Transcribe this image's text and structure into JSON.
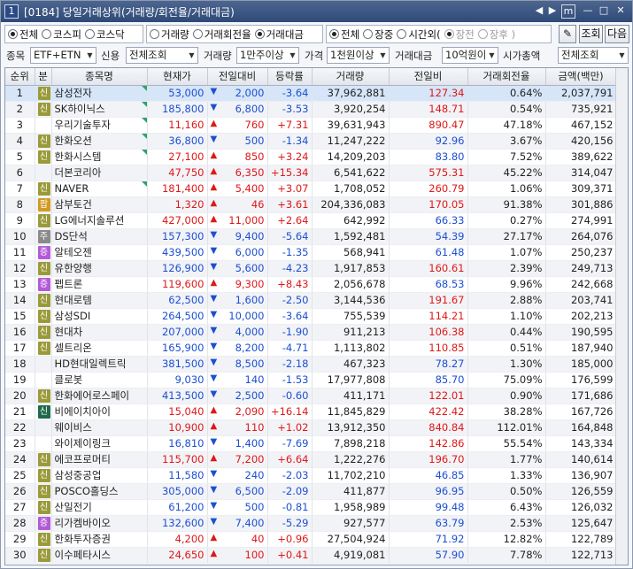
{
  "window": {
    "number": "1",
    "title": "[0184] 당일거래상위(거래량/회전율/거래대금)"
  },
  "title_controls": {
    "prev": "◀",
    "next": "▶",
    "m": "m",
    "minimize": "—",
    "maximize": "□",
    "close": "✕"
  },
  "market_filter": [
    {
      "label": "전체",
      "on": true
    },
    {
      "label": "코스피",
      "on": false
    },
    {
      "label": "코스닥",
      "on": false
    }
  ],
  "sort_filter": [
    {
      "label": "거래량",
      "on": false
    },
    {
      "label": "거래회전율",
      "on": false
    },
    {
      "label": "거래대금",
      "on": true
    }
  ],
  "session_filter": [
    {
      "label": "전체",
      "on": true,
      "dim": false
    },
    {
      "label": "장중",
      "on": false,
      "dim": false
    },
    {
      "label": "시간외(",
      "on": false,
      "dim": false
    },
    {
      "label": "장전",
      "on": true,
      "dim": true
    },
    {
      "label": "장후 )",
      "on": false,
      "dim": true
    }
  ],
  "buttons": {
    "search": "조회",
    "next": "다음",
    "tool_icon": "✎"
  },
  "filters": {
    "item_label": "종목",
    "item_value": "ETF+ETN 제",
    "credit_label": "신용",
    "credit_value": "전체조회",
    "volume_label": "거래량",
    "volume_value": "1만주이상",
    "price_label": "가격",
    "price_value": "1천원이상",
    "amount_label": "거래대금",
    "amount_value": "10억원이상",
    "mcap_label": "시가총액",
    "mcap_value": "전체조회"
  },
  "columns": [
    "순위",
    "분",
    "종목명",
    "현재가",
    "전일대비",
    "등락률",
    "거래량",
    "전일비",
    "거래회전율",
    "금액(백만)"
  ],
  "tag_colors": {
    "신": "#9a9a3a",
    "주": "#8a8a8a",
    "증": "#b35ad6",
    "팝": "#d29a24",
    "신2": "#1f6a4a"
  },
  "rows": [
    {
      "rank": "1",
      "tag": "신",
      "name": "삼성전자",
      "flag": true,
      "price": "53,000",
      "dir": "down",
      "chg": "2,000",
      "rate": "-3.64",
      "vol": "37,962,881",
      "prev": "127.34",
      "turn": "0.64%",
      "amt": "2,037,791"
    },
    {
      "rank": "2",
      "tag": "신",
      "name": "SK하이닉스",
      "flag": true,
      "price": "185,800",
      "dir": "down",
      "chg": "6,800",
      "rate": "-3.53",
      "vol": "3,920,254",
      "prev": "148.71",
      "turn": "0.54%",
      "amt": "735,921"
    },
    {
      "rank": "3",
      "tag": "",
      "name": "우리기술투자",
      "flag": true,
      "price": "11,160",
      "dir": "up",
      "chg": "760",
      "rate": "+7.31",
      "vol": "39,631,943",
      "prev": "890.47",
      "turn": "47.18%",
      "amt": "467,152"
    },
    {
      "rank": "4",
      "tag": "신",
      "name": "한화오션",
      "flag": true,
      "price": "36,800",
      "dir": "down",
      "chg": "500",
      "rate": "-1.34",
      "vol": "11,247,222",
      "prev": "92.96",
      "turn": "3.67%",
      "amt": "420,156"
    },
    {
      "rank": "5",
      "tag": "신",
      "name": "한화시스템",
      "flag": true,
      "price": "27,100",
      "dir": "up",
      "chg": "850",
      "rate": "+3.24",
      "vol": "14,209,203",
      "prev": "83.80",
      "turn": "7.52%",
      "amt": "389,622"
    },
    {
      "rank": "6",
      "tag": "",
      "name": "더본코리아",
      "flag": false,
      "price": "47,750",
      "dir": "up",
      "chg": "6,350",
      "rate": "+15.34",
      "vol": "6,541,622",
      "prev": "575.31",
      "turn": "45.22%",
      "amt": "314,047"
    },
    {
      "rank": "7",
      "tag": "신",
      "name": "NAVER",
      "flag": true,
      "price": "181,400",
      "dir": "up",
      "chg": "5,400",
      "rate": "+3.07",
      "vol": "1,708,052",
      "prev": "260.79",
      "turn": "1.06%",
      "amt": "309,371"
    },
    {
      "rank": "8",
      "tag": "팝",
      "name": "삼부토건",
      "flag": false,
      "price": "1,320",
      "dir": "up",
      "chg": "46",
      "rate": "+3.61",
      "vol": "204,336,083",
      "prev": "170.05",
      "turn": "91.38%",
      "amt": "301,886"
    },
    {
      "rank": "9",
      "tag": "신",
      "name": "LG에너지솔루션",
      "flag": false,
      "price": "427,000",
      "dir": "up",
      "chg": "11,000",
      "rate": "+2.64",
      "vol": "642,992",
      "prev": "66.33",
      "turn": "0.27%",
      "amt": "274,991"
    },
    {
      "rank": "10",
      "tag": "주",
      "name": "DS단석",
      "flag": false,
      "price": "157,300",
      "dir": "down",
      "chg": "9,400",
      "rate": "-5.64",
      "vol": "1,592,481",
      "prev": "54.39",
      "turn": "27.17%",
      "amt": "264,076"
    },
    {
      "rank": "11",
      "tag": "증",
      "name": "알테오젠",
      "flag": false,
      "price": "439,500",
      "dir": "down",
      "chg": "6,000",
      "rate": "-1.35",
      "vol": "568,941",
      "prev": "61.48",
      "turn": "1.07%",
      "amt": "250,237"
    },
    {
      "rank": "12",
      "tag": "신",
      "name": "유한양행",
      "flag": false,
      "price": "126,900",
      "dir": "down",
      "chg": "5,600",
      "rate": "-4.23",
      "vol": "1,917,853",
      "prev": "160.61",
      "turn": "2.39%",
      "amt": "249,713"
    },
    {
      "rank": "13",
      "tag": "증",
      "name": "펩트론",
      "flag": false,
      "price": "119,600",
      "dir": "up",
      "chg": "9,300",
      "rate": "+8.43",
      "vol": "2,056,678",
      "prev": "68.53",
      "turn": "9.96%",
      "amt": "242,668"
    },
    {
      "rank": "14",
      "tag": "신",
      "name": "현대로템",
      "flag": false,
      "price": "62,500",
      "dir": "down",
      "chg": "1,600",
      "rate": "-2.50",
      "vol": "3,144,536",
      "prev": "191.67",
      "turn": "2.88%",
      "amt": "203,741"
    },
    {
      "rank": "15",
      "tag": "신",
      "name": "삼성SDI",
      "flag": false,
      "price": "264,500",
      "dir": "down",
      "chg": "10,000",
      "rate": "-3.64",
      "vol": "755,539",
      "prev": "114.21",
      "turn": "1.10%",
      "amt": "202,213"
    },
    {
      "rank": "16",
      "tag": "신",
      "name": "현대차",
      "flag": false,
      "price": "207,000",
      "dir": "down",
      "chg": "4,000",
      "rate": "-1.90",
      "vol": "911,213",
      "prev": "106.38",
      "turn": "0.44%",
      "amt": "190,595"
    },
    {
      "rank": "17",
      "tag": "신",
      "name": "셀트리온",
      "flag": false,
      "price": "165,900",
      "dir": "down",
      "chg": "8,200",
      "rate": "-4.71",
      "vol": "1,113,802",
      "prev": "110.85",
      "turn": "0.51%",
      "amt": "187,940"
    },
    {
      "rank": "18",
      "tag": "",
      "name": "HD현대일렉트릭",
      "flag": false,
      "price": "381,500",
      "dir": "down",
      "chg": "8,500",
      "rate": "-2.18",
      "vol": "467,323",
      "prev": "78.27",
      "turn": "1.30%",
      "amt": "185,000"
    },
    {
      "rank": "19",
      "tag": "",
      "name": "클로봇",
      "flag": false,
      "price": "9,030",
      "dir": "down",
      "chg": "140",
      "rate": "-1.53",
      "vol": "17,977,808",
      "prev": "85.70",
      "turn": "75.09%",
      "amt": "176,599"
    },
    {
      "rank": "20",
      "tag": "신",
      "name": "한화에어로스페이",
      "flag": false,
      "price": "413,500",
      "dir": "down",
      "chg": "2,500",
      "rate": "-0.60",
      "vol": "411,171",
      "prev": "122.01",
      "turn": "0.90%",
      "amt": "171,686"
    },
    {
      "rank": "21",
      "tag": "신2",
      "name": "비에이치아이",
      "flag": false,
      "price": "15,040",
      "dir": "up",
      "chg": "2,090",
      "rate": "+16.14",
      "vol": "11,845,829",
      "prev": "422.42",
      "turn": "38.28%",
      "amt": "167,726"
    },
    {
      "rank": "22",
      "tag": "",
      "name": "웨이비스",
      "flag": false,
      "price": "10,900",
      "dir": "up",
      "chg": "110",
      "rate": "+1.02",
      "vol": "13,912,350",
      "prev": "840.84",
      "turn": "112.01%",
      "amt": "164,848"
    },
    {
      "rank": "23",
      "tag": "",
      "name": "와이제이링크",
      "flag": false,
      "price": "16,810",
      "dir": "down",
      "chg": "1,400",
      "rate": "-7.69",
      "vol": "7,898,218",
      "prev": "142.86",
      "turn": "55.54%",
      "amt": "143,334"
    },
    {
      "rank": "24",
      "tag": "신",
      "name": "에코프로머티",
      "flag": false,
      "price": "115,700",
      "dir": "up",
      "chg": "7,200",
      "rate": "+6.64",
      "vol": "1,222,276",
      "prev": "196.70",
      "turn": "1.77%",
      "amt": "140,614"
    },
    {
      "rank": "25",
      "tag": "신",
      "name": "삼성중공업",
      "flag": false,
      "price": "11,580",
      "dir": "down",
      "chg": "240",
      "rate": "-2.03",
      "vol": "11,702,210",
      "prev": "46.85",
      "turn": "1.33%",
      "amt": "136,907"
    },
    {
      "rank": "26",
      "tag": "신",
      "name": "POSCO홀딩스",
      "flag": false,
      "price": "305,000",
      "dir": "down",
      "chg": "6,500",
      "rate": "-2.09",
      "vol": "411,877",
      "prev": "96.95",
      "turn": "0.50%",
      "amt": "126,559"
    },
    {
      "rank": "27",
      "tag": "신",
      "name": "산일전기",
      "flag": false,
      "price": "61,200",
      "dir": "down",
      "chg": "500",
      "rate": "-0.81",
      "vol": "1,958,989",
      "prev": "99.48",
      "turn": "6.43%",
      "amt": "126,032"
    },
    {
      "rank": "28",
      "tag": "증",
      "name": "리가켐바이오",
      "flag": false,
      "price": "132,600",
      "dir": "down",
      "chg": "7,400",
      "rate": "-5.29",
      "vol": "927,577",
      "prev": "63.79",
      "turn": "2.53%",
      "amt": "125,647"
    },
    {
      "rank": "29",
      "tag": "신",
      "name": "한화투자증권",
      "flag": false,
      "price": "4,200",
      "dir": "up",
      "chg": "40",
      "rate": "+0.96",
      "vol": "27,504,924",
      "prev": "71.92",
      "turn": "12.82%",
      "amt": "122,789"
    },
    {
      "rank": "30",
      "tag": "신",
      "name": "이수페타시스",
      "flag": false,
      "price": "24,650",
      "dir": "up",
      "chg": "100",
      "rate": "+0.41",
      "vol": "4,919,081",
      "prev": "57.90",
      "turn": "7.78%",
      "amt": "122,713"
    }
  ]
}
